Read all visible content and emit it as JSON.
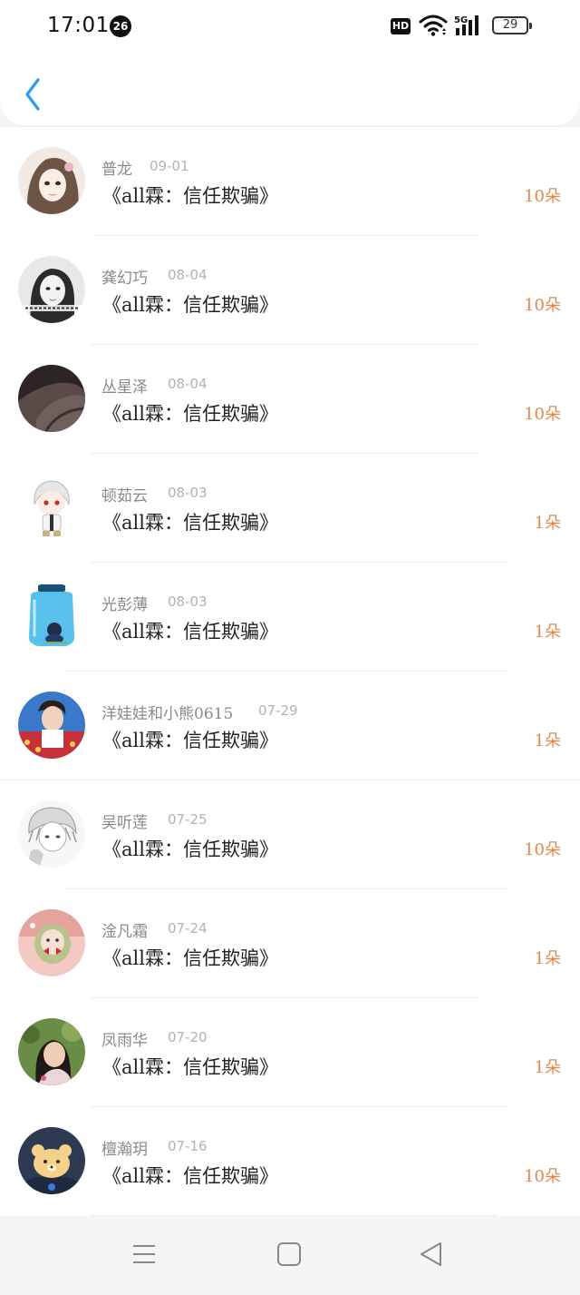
{
  "status_bar": {
    "time": "17:01",
    "notification_count": "26",
    "hd_label": "HD",
    "network_label": "5G",
    "battery": "29"
  },
  "header": {
    "back_icon": "chevron-left-icon",
    "accent_color": "#2a9af0"
  },
  "main": {
    "count_color": "#e0884a",
    "rows": [
      {
        "name": "普龙",
        "date": "09-01",
        "title": "《all霖：信任欺骗》",
        "count": "10朵",
        "avatar": "anime-girl"
      },
      {
        "name": "龚幻巧",
        "date": "08-04",
        "title": "《all霖：信任欺骗》",
        "count": "10朵",
        "avatar": "bw-portrait"
      },
      {
        "name": "丛星泽",
        "date": "08-04",
        "title": "《all霖：信任欺骗》",
        "count": "10朵",
        "avatar": "dark-photo"
      },
      {
        "name": "顿茹云",
        "date": "08-03",
        "title": "《all霖：信任欺骗》",
        "count": "1朵",
        "avatar": "chibi-boy"
      },
      {
        "name": "光彭薄",
        "date": "08-03",
        "title": "《all霖：信任欺骗》",
        "count": "1朵",
        "avatar": "jar"
      },
      {
        "name": "洋娃娃和小熊0615",
        "date": "07-29",
        "title": "《all霖：信任欺骗》",
        "count": "1朵",
        "avatar": "photo-colorful"
      },
      {
        "name": "吴听莲",
        "date": "07-25",
        "title": "《all霖：信任欺骗》",
        "count": "10朵",
        "avatar": "sketch-boy"
      },
      {
        "name": "淦凡霜",
        "date": "07-24",
        "title": "《all霖：信任欺骗》",
        "count": "1朵",
        "avatar": "baby-pink"
      },
      {
        "name": "凤雨华",
        "date": "07-20",
        "title": "《all霖：信任欺骗》",
        "count": "1朵",
        "avatar": "girl-photo"
      },
      {
        "name": "檀瀚玥",
        "date": "07-16",
        "title": "《all霖：信任欺骗》",
        "count": "10朵",
        "avatar": "bear"
      }
    ]
  },
  "navbar": {
    "items": [
      "menu-icon",
      "home-square-icon",
      "back-triangle-icon"
    ]
  }
}
